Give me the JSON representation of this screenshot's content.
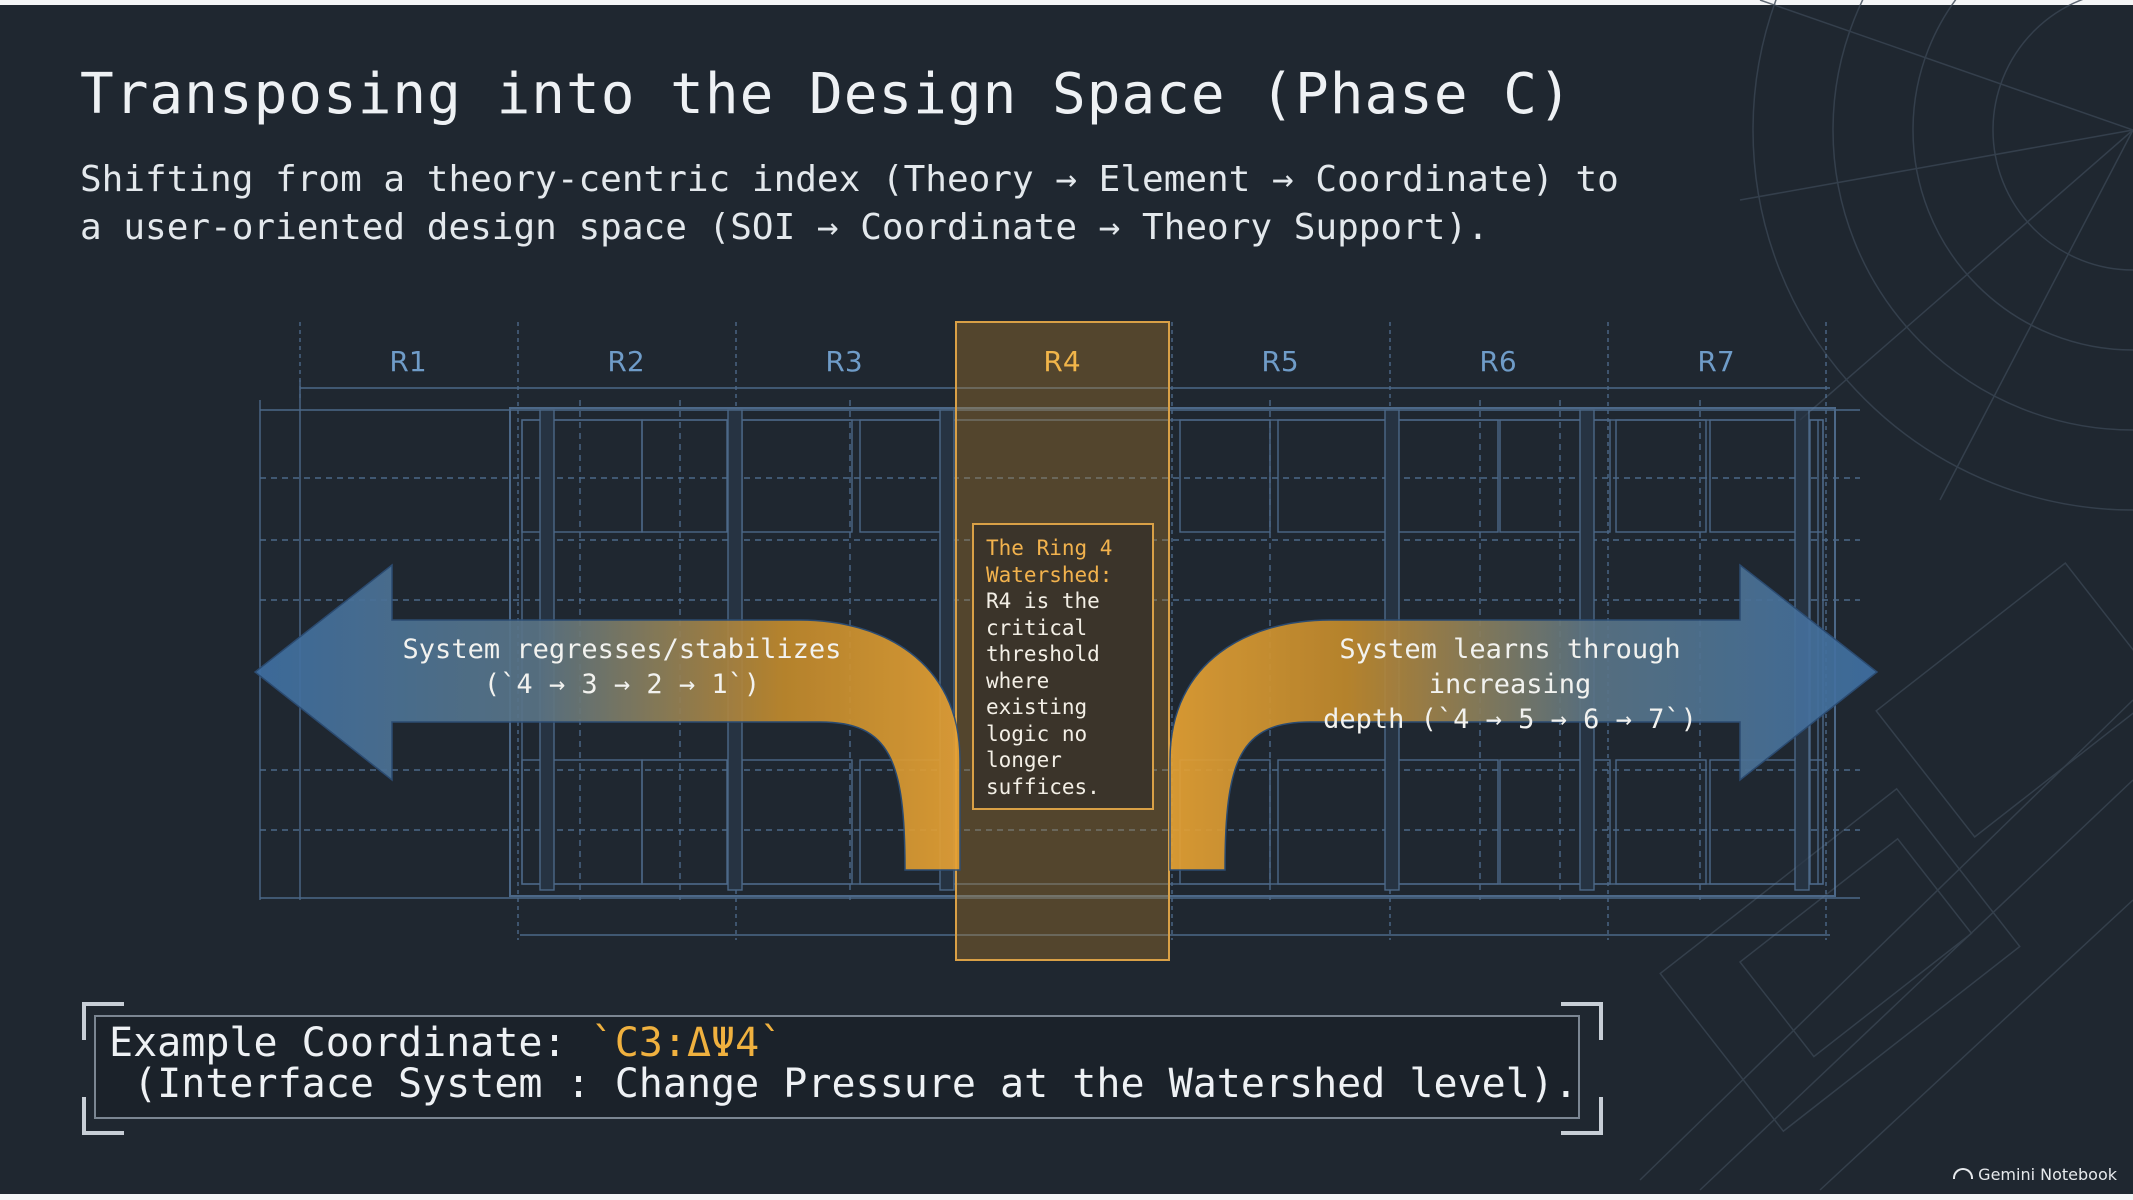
{
  "title": "Transposing into the Design Space (Phase C)",
  "subtitle": "Shifting from a theory-centric index (Theory → Element → Coordinate) to\na user-oriented design space (SOI → Coordinate → Theory Support).",
  "rings": [
    "R1",
    "R2",
    "R3",
    "R4",
    "R5",
    "R6",
    "R7"
  ],
  "highlighted_ring": "R4",
  "callout": {
    "heading": "The Ring 4\nWatershed:",
    "body": "R4 is the\ncritical\nthreshold\nwhere\nexisting\nlogic no\nlonger\nsuffices."
  },
  "left_arrow": {
    "text": "System regresses/stabilizes\n(`4 → 3 → 2 → 1`)",
    "icon": "arrow-left-icon"
  },
  "right_arrow": {
    "text": "System learns through increasing\ndepth (`4 → 5 → 6 → 7`)",
    "icon": "arrow-right-icon"
  },
  "example": {
    "label": "Example Coordinate: ",
    "coordinate": "`C3:ΔΨ4`",
    "description": " (Interface System : Change Pressure at the Watershed level)."
  },
  "watermark": "Gemini Notebook",
  "colors": {
    "background": "#1f2730",
    "blueprint_line": "#5d7fa6",
    "ring_label": "#6f9cc8",
    "accent_amber": "#f0b13f",
    "arrow_blue": "#3f6fa3"
  }
}
